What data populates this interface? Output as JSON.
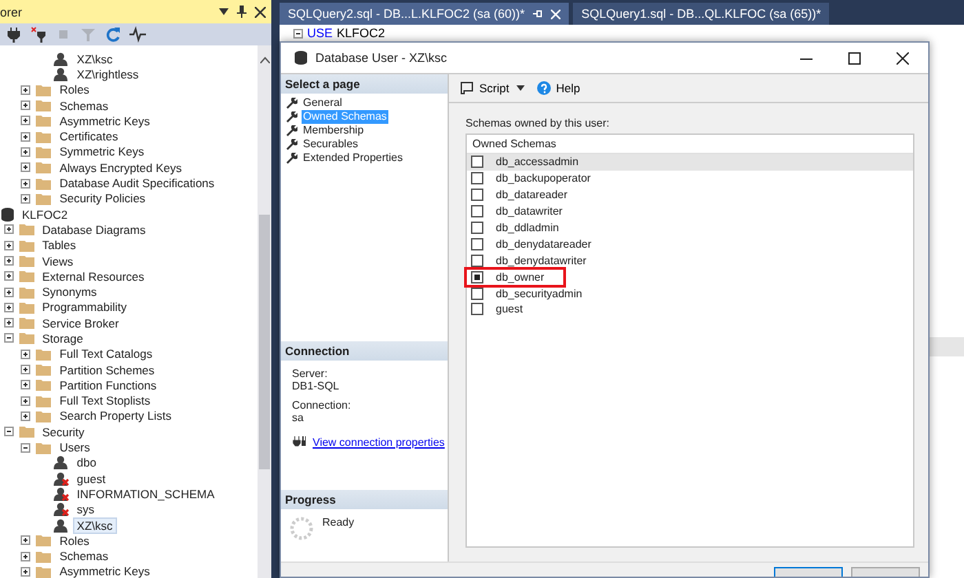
{
  "explorer": {
    "title": "orer",
    "toolbar": [
      {
        "kind": "connect",
        "disabled": false
      },
      {
        "kind": "disconnect",
        "disabled": false
      },
      {
        "kind": "stop",
        "disabled": true
      },
      {
        "kind": "filter",
        "disabled": true
      },
      {
        "kind": "refresh",
        "disabled": false
      },
      {
        "kind": "activity",
        "disabled": false
      }
    ],
    "tree": [
      {
        "children": [
          {
            "children": [
              {
                "children": [
                  {
                    "label": "XZ\\ksc",
                    "kind": "user",
                    "disabled": false,
                    "selected": false
                  },
                  {
                    "label": "XZ\\rightless",
                    "kind": "user",
                    "disabled": false,
                    "selected": false
                  }
                ]
              },
              {
                "label": "Roles",
                "kind": "folder",
                "expanded": false,
                "selected": false
              },
              {
                "label": "Schemas",
                "kind": "folder",
                "expanded": false,
                "selected": false
              },
              {
                "label": "Asymmetric Keys",
                "kind": "folder",
                "expanded": false,
                "selected": false
              },
              {
                "label": "Certificates",
                "kind": "folder",
                "expanded": false,
                "selected": false
              },
              {
                "label": "Symmetric Keys",
                "kind": "folder",
                "expanded": false,
                "selected": false
              },
              {
                "label": "Always Encrypted Keys",
                "kind": "folder",
                "expanded": false,
                "selected": false
              },
              {
                "label": "Database Audit Specifications",
                "kind": "folder",
                "expanded": false,
                "selected": false
              },
              {
                "label": "Security Policies",
                "kind": "folder",
                "expanded": false,
                "selected": false
              }
            ]
          }
        ]
      },
      {
        "label": "KLFOC2",
        "kind": "database",
        "selected": false,
        "children": [
          {
            "label": "Database Diagrams",
            "kind": "folder",
            "expanded": false,
            "selected": false
          },
          {
            "label": "Tables",
            "kind": "folder",
            "expanded": false,
            "selected": false
          },
          {
            "label": "Views",
            "kind": "folder",
            "expanded": false,
            "selected": false
          },
          {
            "label": "External Resources",
            "kind": "folder",
            "expanded": false,
            "selected": false
          },
          {
            "label": "Synonyms",
            "kind": "folder",
            "expanded": false,
            "selected": false
          },
          {
            "label": "Programmability",
            "kind": "folder",
            "expanded": false,
            "selected": false
          },
          {
            "label": "Service Broker",
            "kind": "folder",
            "expanded": false,
            "selected": false
          },
          {
            "label": "Storage",
            "kind": "folder",
            "expanded": true,
            "selected": false,
            "children": [
              {
                "label": "Full Text Catalogs",
                "kind": "folder",
                "expanded": false,
                "selected": false
              },
              {
                "label": "Partition Schemes",
                "kind": "folder",
                "expanded": false,
                "selected": false
              },
              {
                "label": "Partition Functions",
                "kind": "folder",
                "expanded": false,
                "selected": false
              },
              {
                "label": "Full Text Stoplists",
                "kind": "folder",
                "expanded": false,
                "selected": false
              },
              {
                "label": "Search Property Lists",
                "kind": "folder",
                "expanded": false,
                "selected": false
              }
            ]
          },
          {
            "label": "Security",
            "kind": "folder",
            "expanded": true,
            "selected": false,
            "children": [
              {
                "label": "Users",
                "kind": "folder",
                "expanded": true,
                "selected": false,
                "children": [
                  {
                    "label": "dbo",
                    "kind": "user",
                    "disabled": false,
                    "selected": false
                  },
                  {
                    "label": "guest",
                    "kind": "user",
                    "disabled": true,
                    "selected": false
                  },
                  {
                    "label": "INFORMATION_SCHEMA",
                    "kind": "user",
                    "disabled": true,
                    "selected": false
                  },
                  {
                    "label": "sys",
                    "kind": "user",
                    "disabled": true,
                    "selected": false
                  },
                  {
                    "label": "XZ\\ksc",
                    "kind": "user",
                    "disabled": false,
                    "selected": true
                  }
                ]
              },
              {
                "label": "Roles",
                "kind": "folder",
                "expanded": false,
                "selected": false
              },
              {
                "label": "Schemas",
                "kind": "folder",
                "expanded": false,
                "selected": false
              },
              {
                "label": "Asymmetric Keys",
                "kind": "folder",
                "expanded": false,
                "selected": false
              }
            ]
          }
        ]
      }
    ]
  },
  "tabs": [
    {
      "label": "SQLQuery2.sql - DB...L.KLFOC2 (sa (60))*",
      "selected": true
    },
    {
      "label": "SQLQuery1.sql - DB...QL.KLFOC (sa (65))*",
      "selected": false
    }
  ],
  "editor": {
    "keyword": "USE",
    "identifier": "KLFOC2"
  },
  "dialog": {
    "title": "Database User - XZ\\ksc",
    "pages_header": "Select a page",
    "pages": [
      {
        "label": "General",
        "selected": false
      },
      {
        "label": "Owned Schemas",
        "selected": true
      },
      {
        "label": "Membership",
        "selected": false
      },
      {
        "label": "Securables",
        "selected": false
      },
      {
        "label": "Extended Properties",
        "selected": false
      }
    ],
    "connection": {
      "header": "Connection",
      "server_label": "Server:",
      "server": "DB1-SQL",
      "connection_label": "Connection:",
      "connection": "sa",
      "link": "View connection properties"
    },
    "progress": {
      "header": "Progress",
      "status": "Ready"
    },
    "toolbar": {
      "script": "Script",
      "help": "Help"
    },
    "schemas_label": "Schemas owned by this user:",
    "list_header": "Owned Schemas",
    "schemas": [
      {
        "name": "db_accessadmin",
        "checked": false,
        "selected": true,
        "marked": false
      },
      {
        "name": "db_backupoperator",
        "checked": false,
        "selected": false,
        "marked": false
      },
      {
        "name": "db_datareader",
        "checked": false,
        "selected": false,
        "marked": false
      },
      {
        "name": "db_datawriter",
        "checked": false,
        "selected": false,
        "marked": false
      },
      {
        "name": "db_ddladmin",
        "checked": false,
        "selected": false,
        "marked": false
      },
      {
        "name": "db_denydatareader",
        "checked": false,
        "selected": false,
        "marked": false
      },
      {
        "name": "db_denydatawriter",
        "checked": false,
        "selected": false,
        "marked": false
      },
      {
        "name": "db_owner",
        "checked": true,
        "selected": false,
        "marked": true
      },
      {
        "name": "db_securityadmin",
        "checked": false,
        "selected": false,
        "marked": false
      },
      {
        "name": "guest",
        "checked": false,
        "selected": false,
        "marked": false
      }
    ]
  }
}
